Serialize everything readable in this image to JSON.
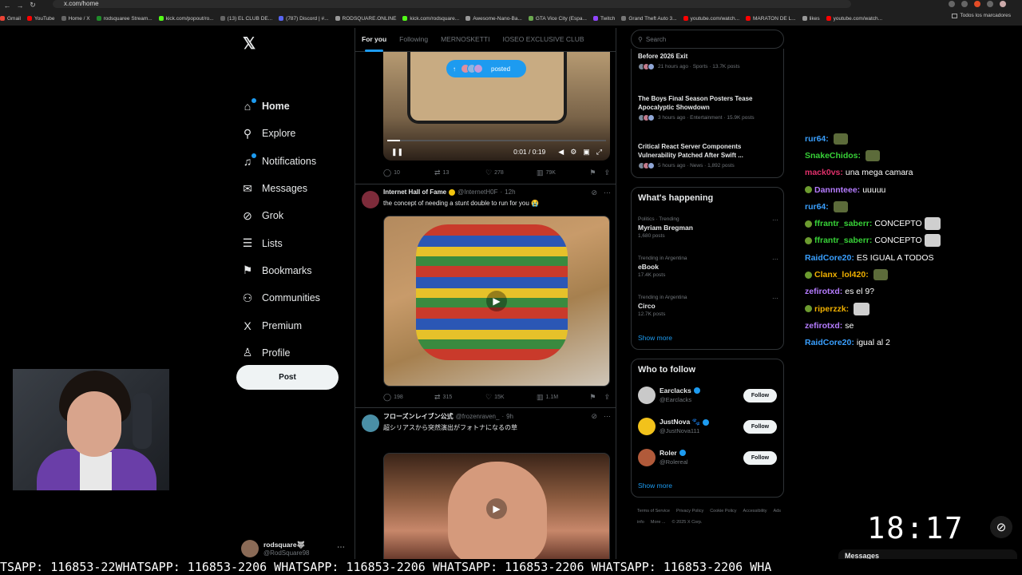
{
  "browser": {
    "url": "x.com/home",
    "bookmarks": [
      "Gmail",
      "YouTube",
      "Home / X",
      "rodsquaree Stream...",
      "kick.com/popout/ro...",
      "(13) EL CLUB DE...",
      "(787) Discord | #...",
      "RODSQUARE.ONLINE",
      "kick.com/rodsquare...",
      "Awesome-Nano-Ba...",
      "GTA Vice City (Espa...",
      "Twitch",
      "Grand Theft Auto 3...",
      "youtube.com/watch...",
      "MARATON DE L...",
      "likes",
      "youtube.com/watch..."
    ],
    "all_bookmarks": "Todos los marcadores"
  },
  "sidebar": {
    "items": [
      {
        "label": "Home",
        "icon": "home-icon",
        "glyph": "⌂"
      },
      {
        "label": "Explore",
        "icon": "search-icon",
        "glyph": "⚲"
      },
      {
        "label": "Notifications",
        "icon": "bell-icon",
        "glyph": "♫"
      },
      {
        "label": "Messages",
        "icon": "mail-icon",
        "glyph": "✉"
      },
      {
        "label": "Grok",
        "icon": "grok-icon",
        "glyph": "⊘"
      },
      {
        "label": "Lists",
        "icon": "list-icon",
        "glyph": "☰"
      },
      {
        "label": "Bookmarks",
        "icon": "bookmark-icon",
        "glyph": "⚑"
      },
      {
        "label": "Communities",
        "icon": "communities-icon",
        "glyph": "⚇"
      },
      {
        "label": "Premium",
        "icon": "x-icon",
        "glyph": "X"
      },
      {
        "label": "Profile",
        "icon": "profile-icon",
        "glyph": "♙"
      },
      {
        "label": "More",
        "icon": "more-icon",
        "glyph": "⋯"
      }
    ],
    "post_label": "Post",
    "account_name": "rodsquare🐺",
    "account_handle": "@RodSquare98",
    "logo": "𝕏"
  },
  "feed": {
    "tabs": [
      "For you",
      "Following",
      "MERNOSKETTI",
      "IOSEO EXCLUSIVE CLUB"
    ],
    "posted_label": "posted",
    "video_time": "0:01 / 0:19",
    "tweet0_actions": {
      "replies": "10",
      "reposts": "13",
      "likes": "278",
      "views": "79K"
    },
    "tweet1": {
      "name": "Internet Hall of Fame",
      "handle": "@InternetH0F",
      "time": "12h",
      "text": "the concept of needing a stunt double to run for you 😭",
      "actions": {
        "replies": "198",
        "reposts": "315",
        "likes": "15K",
        "views": "1.1M"
      }
    },
    "tweet2": {
      "name": "フローズンレイブン公式",
      "handle": "@frozenraven_",
      "time": "9h",
      "text": "超シリアスから突然演出がフォトナになるの草"
    }
  },
  "right": {
    "search_placeholder": "Search",
    "news": [
      {
        "title": "Before 2026 Exit",
        "meta": "21 hours ago · Sports · 13.7K posts"
      },
      {
        "title": "The Boys Final Season Posters Tease Apocalyptic Showdown",
        "meta": "3 hours ago · Entertainment · 15.9K posts"
      },
      {
        "title": "Critical React Server Components Vulnerability Patched After Swift ...",
        "meta": "5 hours ago · News · 1,892 posts"
      }
    ],
    "happening_title": "What's happening",
    "trends": [
      {
        "context": "Politics · Trending",
        "name": "Myriam Bregman",
        "count": "1,680 posts"
      },
      {
        "context": "Trending in Argentina",
        "name": "eBook",
        "count": "17.4K posts"
      },
      {
        "context": "Trending in Argentina",
        "name": "Circo",
        "count": "12.7K posts"
      }
    ],
    "show_more": "Show more",
    "wtf_title": "Who to follow",
    "follow_label": "Follow",
    "who_to_follow": [
      {
        "name": "Earclacks",
        "handle": "@Earclacks",
        "color": "#c9c9c9"
      },
      {
        "name": "JustNova 🐾",
        "handle": "@JustNova111",
        "color": "#f2c21b"
      },
      {
        "name": "Roler",
        "handle": "@Rolereal",
        "color": "#b15a3a"
      }
    ],
    "footer": [
      "Terms of Service",
      "Privacy Policy",
      "Cookie Policy",
      "Accessibility",
      "Ads info",
      "More ...",
      "© 2025 X Corp."
    ]
  },
  "chat": [
    {
      "user": "rur64:",
      "color": "#3aa0ff",
      "msg": "",
      "emote": "emote"
    },
    {
      "user": "SnakeChidos:",
      "color": "#37d137",
      "msg": "",
      "emote": "emote"
    },
    {
      "user": "mack0vs:",
      "color": "#e0306b",
      "msg": "una mega camara",
      "emote": ""
    },
    {
      "user": "Dannnteee:",
      "color": "#b57cff",
      "msg": "uuuuu",
      "emote": "",
      "badge": true
    },
    {
      "user": "rur64:",
      "color": "#3aa0ff",
      "msg": "",
      "emote": "emote"
    },
    {
      "user": "ffrantr_saberr:",
      "color": "#37d137",
      "msg": "CONCEPTO",
      "emote": "img",
      "badge": true
    },
    {
      "user": "ffrantr_saberr:",
      "color": "#37d137",
      "msg": "CONCEPTO",
      "emote": "img",
      "badge": true
    },
    {
      "user": "RaidCore20:",
      "color": "#3aa0ff",
      "msg": "ES IGUAL A TODOS",
      "emote": ""
    },
    {
      "user": "Clanx_lol420:",
      "color": "#f0b000",
      "msg": "",
      "emote": "emote",
      "badge": true
    },
    {
      "user": "zefirotxd:",
      "color": "#b57cff",
      "msg": "es el 9?",
      "emote": ""
    },
    {
      "user": "riperzzk:",
      "color": "#f0b000",
      "msg": "",
      "emote": "img",
      "badge": true
    },
    {
      "user": "zefirotxd:",
      "color": "#b57cff",
      "msg": "se",
      "emote": ""
    },
    {
      "user": "RaidCore20:",
      "color": "#3aa0ff",
      "msg": "igual al 2",
      "emote": ""
    }
  ],
  "overlay": {
    "clock": "18:17",
    "messages_label": "Messages",
    "ticker": "TSAPP: 116853-22WHATSAPP: 116853-2206 WHATSAPP: 116853-2206 WHATSAPP: 116853-2206 WHATSAPP: 116853-2206 WHA"
  }
}
